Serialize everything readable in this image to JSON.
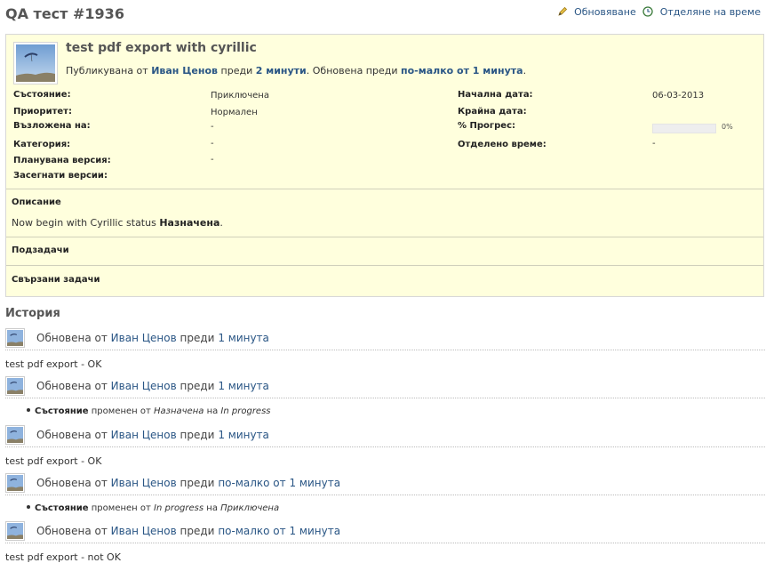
{
  "issue": {
    "title": "QA тест #1936",
    "subject": "test pdf export with cyrillic",
    "author_prefix": "Публикувана от",
    "author_name": "Иван Ценов",
    "ago_word": "преди",
    "created_ago": "2 минути",
    "updated_sep": ". Обновена преди",
    "updated_ago": "по-малко от 1 минута",
    "end_dot": "."
  },
  "actions": {
    "edit_label": "Обновяване",
    "log_time_label": "Отделяне на време",
    "accent": "#2a5685"
  },
  "attributes": {
    "status_label": "Състояние:",
    "status_value": "Приключена",
    "priority_label": "Приоритет:",
    "priority_value": "Нормален",
    "assigned_label": "Възложена на:",
    "assigned_value": "-",
    "category_label": "Категория:",
    "category_value": "-",
    "version_label": "Планувана версия:",
    "version_value": "-",
    "affected_label": "Засегнати версии:",
    "start_label": "Начална дата:",
    "start_value": "06-03-2013",
    "due_label": "Крайна дата:",
    "progress_label": "% Прогрес:",
    "progress_value": "0%",
    "progress_fraction": 0,
    "spent_label": "Отделено време:",
    "spent_value": "-"
  },
  "description": {
    "heading": "Описание",
    "text_before": "Now begin with Cyrillic status ",
    "text_bold": "Назначена",
    "text_after": "."
  },
  "sections": {
    "subtasks": "Подзадачи",
    "relations": "Свързани задачи"
  },
  "history": {
    "heading": "История",
    "updated_by": "Обновена от",
    "ago_word": "преди",
    "changed_word": "променен от",
    "to_word": "на",
    "journals": [
      {
        "author": "Иван Ценов",
        "ago": "1 минута",
        "notes": "test pdf export - OK"
      },
      {
        "author": "Иван Ценов",
        "ago": "1 минута",
        "field": "Състояние",
        "old": "Назначена",
        "new": "In progress"
      },
      {
        "author": "Иван Ценов",
        "ago": "1 минута",
        "notes": "test pdf export - OK"
      },
      {
        "author": "Иван Ценов",
        "ago": "по-малко от 1 минута",
        "field": "Състояние",
        "old": "In progress",
        "new": "Приключена"
      },
      {
        "author": "Иван Ценов",
        "ago": "по-малко от 1 минута",
        "notes": "test pdf export - not OK"
      }
    ]
  }
}
